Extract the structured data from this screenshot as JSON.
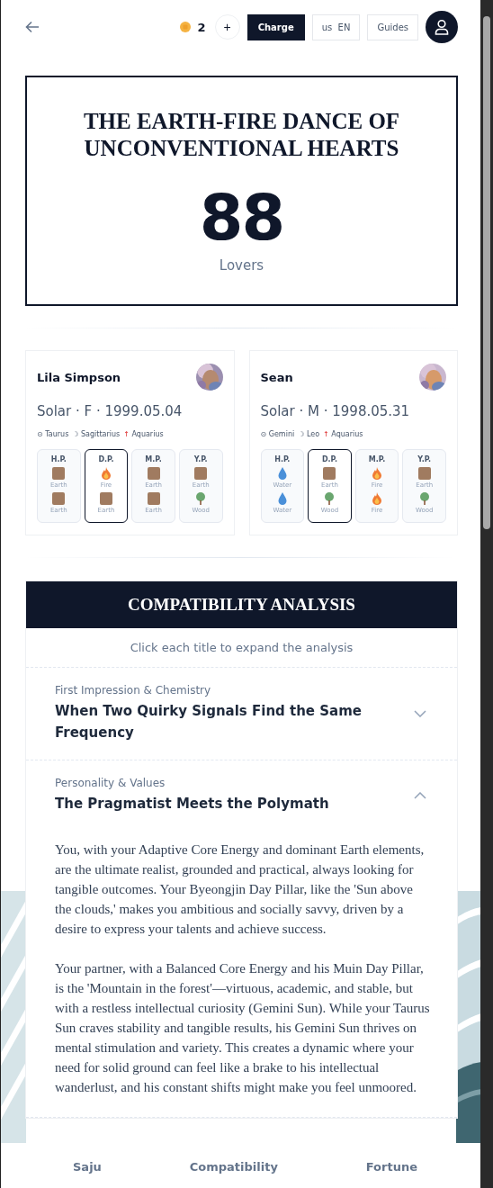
{
  "top_bar": {
    "coins": "2",
    "add": "+",
    "charge": "Charge",
    "language": {
      "region": "us",
      "code": "EN"
    },
    "guides": "Guides"
  },
  "hero": {
    "title": "THE EARTH-FIRE DANCE OF UNCONVENTIONAL HEARTS",
    "score": "88",
    "label": "Lovers"
  },
  "profiles": [
    {
      "name": "Lila Simpson",
      "details": "Solar · F · 1999.05.04",
      "signs": [
        {
          "symbol": "⊙",
          "sign": "Taurus"
        },
        {
          "symbol": "☽",
          "sign": "Sagittarius"
        },
        {
          "symbol": "↑",
          "sign": "Aquarius"
        }
      ],
      "pillars": [
        {
          "label": "H.P.",
          "selected": false,
          "elements": [
            {
              "kind": "earth",
              "label": "Earth"
            },
            {
              "kind": "earth",
              "label": "Earth"
            }
          ]
        },
        {
          "label": "D.P.",
          "selected": true,
          "elements": [
            {
              "kind": "fire",
              "label": "Fire"
            },
            {
              "kind": "earth",
              "label": "Earth"
            }
          ]
        },
        {
          "label": "M.P.",
          "selected": false,
          "elements": [
            {
              "kind": "earth",
              "label": "Earth"
            },
            {
              "kind": "earth",
              "label": "Earth"
            }
          ]
        },
        {
          "label": "Y.P.",
          "selected": false,
          "elements": [
            {
              "kind": "earth",
              "label": "Earth"
            },
            {
              "kind": "wood",
              "label": "Wood"
            }
          ]
        }
      ]
    },
    {
      "name": "Sean",
      "details": "Solar · M · 1998.05.31",
      "signs": [
        {
          "symbol": "⊙",
          "sign": "Gemini"
        },
        {
          "symbol": "☽",
          "sign": "Leo"
        },
        {
          "symbol": "↑",
          "sign": "Aquarius"
        }
      ],
      "pillars": [
        {
          "label": "H.P.",
          "selected": false,
          "elements": [
            {
              "kind": "water",
              "label": "Water"
            },
            {
              "kind": "water",
              "label": "Water"
            }
          ]
        },
        {
          "label": "D.P.",
          "selected": true,
          "elements": [
            {
              "kind": "earth",
              "label": "Earth"
            },
            {
              "kind": "wood",
              "label": "Wood"
            }
          ]
        },
        {
          "label": "M.P.",
          "selected": false,
          "elements": [
            {
              "kind": "fire",
              "label": "Fire"
            },
            {
              "kind": "fire",
              "label": "Fire"
            }
          ]
        },
        {
          "label": "Y.P.",
          "selected": false,
          "elements": [
            {
              "kind": "earth",
              "label": "Earth"
            },
            {
              "kind": "wood",
              "label": "Wood"
            }
          ]
        }
      ]
    }
  ],
  "analysis": {
    "title": "COMPATIBILITY ANALYSIS",
    "hint": "Click each title to expand the analysis",
    "sections": [
      {
        "category": "First Impression & Chemistry",
        "title": "When Two Quirky Signals Find the Same Frequency",
        "expanded": false
      },
      {
        "category": "Personality & Values",
        "title": "The Pragmatist Meets the Polymath",
        "expanded": true,
        "paragraphs": [
          "You, with your Adaptive Core Energy and dominant Earth elements, are the ultimate realist, grounded and practical, always looking for tangible outcomes. Your Byeongjin Day Pillar, like the 'Sun above the clouds,' makes you ambitious and socially savvy, driven by a desire to express your talents and achieve success.",
          "Your partner, with a Balanced Core Energy and his Muin Day Pillar, is the 'Mountain in the forest'—virtuous, academic, and stable, but with a restless intellectual curiosity (Gemini Sun). While your Taurus Sun craves stability and tangible results, his Gemini Sun thrives on mental stimulation and variety. This creates a dynamic where your need for solid ground can feel like a brake to his intellectual wanderlust, and his constant shifts might make you feel unmoored."
        ]
      }
    ]
  },
  "bottom_nav": [
    {
      "label": "Saju"
    },
    {
      "label": "Compatibility"
    },
    {
      "label": "Fortune"
    }
  ]
}
